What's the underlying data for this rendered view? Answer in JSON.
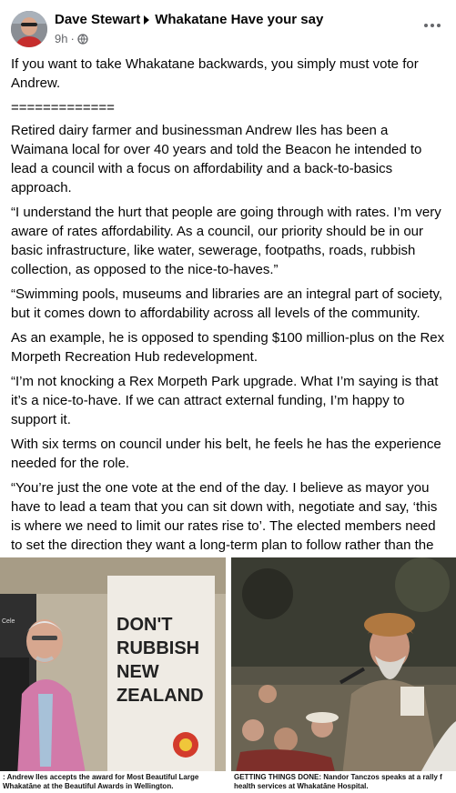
{
  "post": {
    "author": "Dave Stewart",
    "group": "Whakatane Have your say",
    "time": "9h",
    "dot": "·",
    "icons": {
      "privacy": "globe-icon",
      "menu": "more-dots-icon"
    }
  },
  "body": {
    "p1": "If you want to take Whakatane backwards, you simply must vote for Andrew.",
    "p2": "=============",
    "p3": "Retired dairy farmer and businessman Andrew Iles has been a Waimana local for over 40 years and told the Beacon he intended to lead a council with a focus on affordability and a back-to-basics approach.",
    "p4": "“I understand the hurt that people are going through with rates. I’m very aware of rates affordability. As a council, our priority should be in our basic infrastructure, like water, sewerage, footpaths, roads, rubbish collection, as opposed to the nice-to-haves.”",
    "p5": "“Swimming pools, museums and libraries are an integral part of society, but it comes down to affordability across all levels of the community.",
    "p6": "As an example, he is opposed to spending $100 million-plus on the Rex Morpeth Recreation Hub redevelopment.",
    "p7": "“I’m not knocking a Rex Morpeth Park upgrade. What I’m saying is that it’s a nice-to-have. If we can attract external funding, I’m happy to support it.",
    "p8": "With six terms on council under his belt, he feels he has the experience needed for the role.",
    "p9": "“You’re just the one vote at the end of the day. I believe as mayor you have to lead a team that you can sit down with, negotiate and say, ‘this is where we need to limit our rates rise to’. The elected members need to set the direction they want a long-term plan to follow rather than the staff leading."
  },
  "photos": {
    "left_caption": ": Andrew Iles accepts the award for Most Beautiful Large Whakatāne at the Beautiful Awards in Wellington.",
    "banner_line1": "DON'T",
    "banner_line2": "RUBBISH",
    "banner_line3": "NEW",
    "banner_line4": "ZEALAND",
    "sign_prefix": "Cele",
    "right_caption": "GETTING THINGS DONE: Nandor Tanczos speaks at a rally f health services at Whakatāne Hospital."
  }
}
